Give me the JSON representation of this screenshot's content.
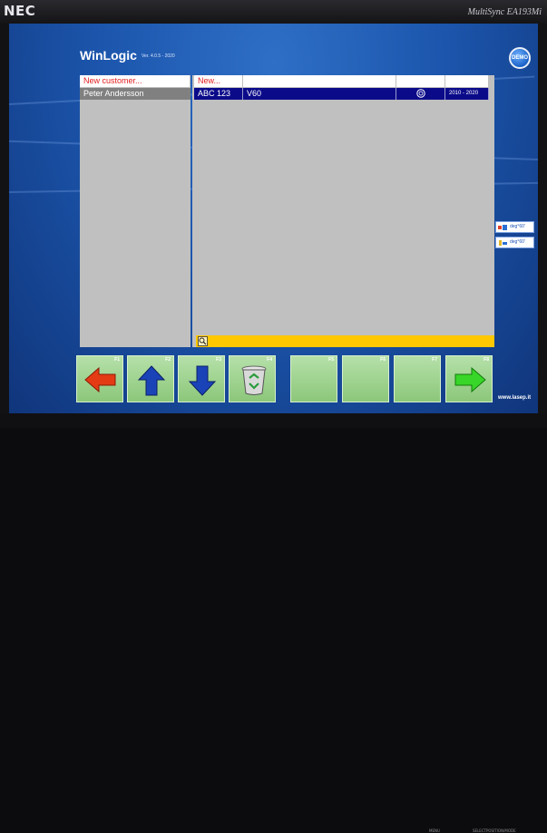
{
  "monitor": {
    "brand": "NEC",
    "model": "MultiSync EA193Mi",
    "controls": [
      "MENU",
      "SELECT",
      "INPUT/SIGNAL",
      "POSITION/MODE"
    ]
  },
  "app": {
    "title": "WinLogic",
    "version": "Ver. 4.0.5 - 2020",
    "badge": "DEMO"
  },
  "customers": {
    "new_label": "New customer...",
    "items": [
      "Peter Andersson"
    ]
  },
  "vehicles": {
    "new_label": "New...",
    "rows": [
      {
        "plate": "ABC 123",
        "model": "V60",
        "icon": "tire-icon",
        "years": "2010 - 2020"
      }
    ]
  },
  "side_indicators": [
    {
      "icon": "vehicle-front-icon",
      "text": "deg°60'"
    },
    {
      "icon": "vehicle-rear-icon",
      "text": "deg°60'"
    }
  ],
  "function_keys": [
    {
      "key": "F1",
      "icon": "arrow-left-icon"
    },
    {
      "key": "F2",
      "icon": "arrow-up-icon"
    },
    {
      "key": "F3",
      "icon": "arrow-down-icon"
    },
    {
      "key": "F4",
      "icon": "recycle-bin-icon"
    },
    {
      "key": "F5",
      "icon": ""
    },
    {
      "key": "F6",
      "icon": ""
    },
    {
      "key": "F7",
      "icon": ""
    },
    {
      "key": "F8",
      "icon": "arrow-right-icon"
    }
  ],
  "website": "www.lasep.it",
  "colors": {
    "selection_blue": "#0b0b8a",
    "status_yellow": "#ffc800",
    "key_green": "#a3d693",
    "new_red": "#e21d1d"
  }
}
